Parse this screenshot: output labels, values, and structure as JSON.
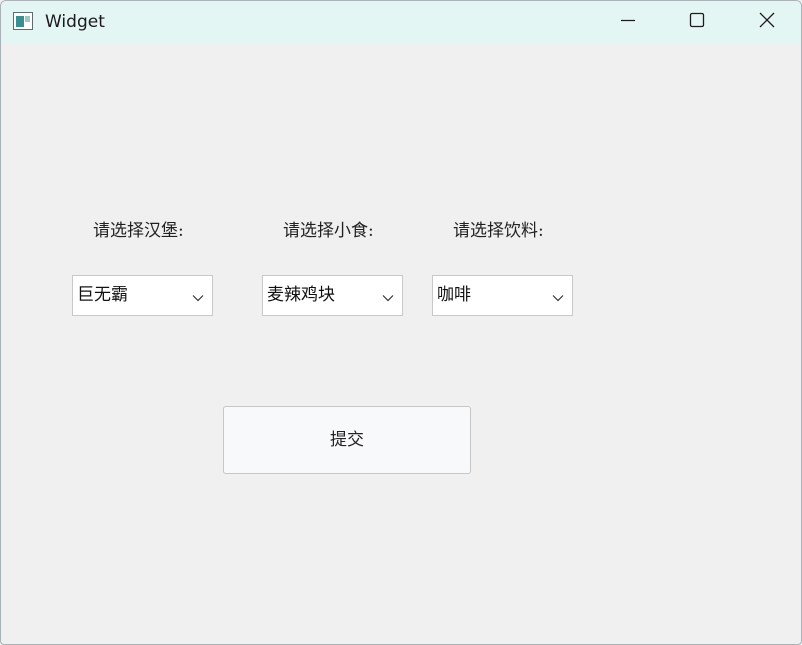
{
  "window": {
    "title": "Widget",
    "icon": "app-window-icon",
    "controls": {
      "minimize_icon": "minimize-icon",
      "maximize_icon": "maximize-icon",
      "close_icon": "close-icon"
    },
    "titlebar_color": "#e4f6f4"
  },
  "form": {
    "burger": {
      "label": "请选择汉堡:",
      "selected": "巨无霸",
      "icon": "chevron-down-icon"
    },
    "snack": {
      "label": "请选择小食:",
      "selected": "麦辣鸡块",
      "icon": "chevron-down-icon"
    },
    "drink": {
      "label": "请选择饮料:",
      "selected": "咖啡",
      "icon": "chevron-down-icon"
    },
    "submit_label": "提交"
  }
}
